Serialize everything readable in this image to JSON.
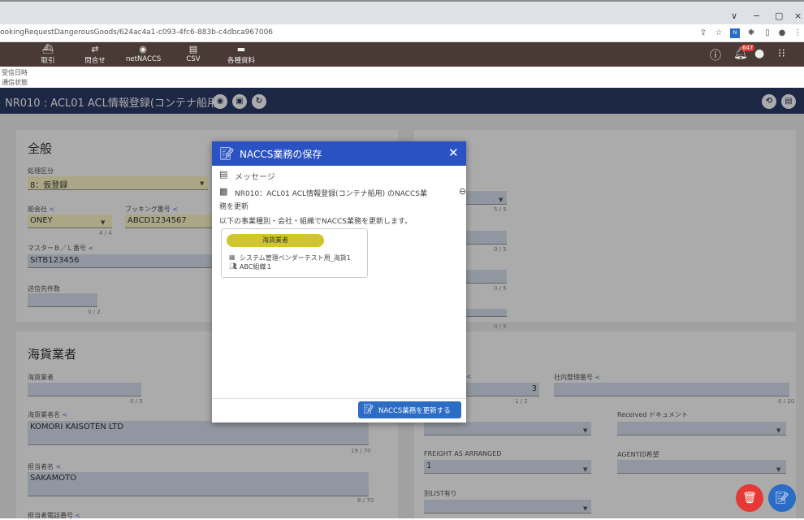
{
  "browser": {
    "url": "ookingRequestDangerousGoods/624ac4a1-c093-4fc6-883b-c4dbca967006",
    "window_controls": [
      "∨",
      "−",
      "▢",
      "×"
    ]
  },
  "toolbar": {
    "items": [
      {
        "label": "取引",
        "icon": "ship-icon"
      },
      {
        "label": "問合せ",
        "icon": "exchange-icon"
      },
      {
        "label": "netNACCS",
        "icon": "globe-icon"
      },
      {
        "label": "CSV",
        "icon": "file-icon"
      },
      {
        "label": "各種資料",
        "icon": "folder-icon"
      }
    ],
    "notification_count": "647"
  },
  "info": {
    "received_datetime_label": "受信日時",
    "comm_status_label": "通信状態"
  },
  "page": {
    "title": "NR010 : ACL01 ACL情報登録(コンテナ船用)"
  },
  "general": {
    "title": "全般",
    "processing_label": "処理区分",
    "processing_value": "8：仮登録",
    "carrier_label": "船会社",
    "carrier_value": "ONEY",
    "carrier_count": "4 / 4",
    "booking_label": "ブッキング番号",
    "booking_value": "ABCD1234567",
    "master_bl_label": "マスターＢ／Ｌ番号",
    "master_bl_value": "SITB123456",
    "sender_label": "送信先件数",
    "sender_count": "0 / 2"
  },
  "right_top": {
    "count1": "5 / 5",
    "count2": "0 / 5",
    "count3": "0 / 5",
    "count4": "0 / 5"
  },
  "forwarder": {
    "title": "海貨業者",
    "code_label": "海貨業者",
    "code_count": "0 / 5",
    "name_label": "海貨業者名",
    "name_value": "KOMORI KAISOTEN LTD",
    "name_count": "19 / 70",
    "person_label": "担当者名",
    "person_value": "SAKAMOTO",
    "person_count": "8 / 70",
    "phone_label": "担当者電話番号"
  },
  "right_bottom": {
    "value3": "3",
    "count_1_2": "1 / 2",
    "internal_label": "社内整理番号",
    "internal_count": "0 / 20",
    "received_doc_label": "Received ドキュメント",
    "freight_label": "FREIGHT AS ARRANGED",
    "freight_value": "1",
    "agent_label": "AGENT印希望",
    "list_label": "別LIST有り"
  },
  "dialog": {
    "title": "NACCS業務の保存",
    "message_label": "メッセージ",
    "message_line1": "NR010：ACL01 ACL情報登録(コンテナ船用) のNACCS業",
    "message_line2": "務を更新",
    "message_line3": "以下の事業種別・会社・組織でNACCS業務を更新します。",
    "chip": "海貨業者",
    "company": "システム管理ベンダーテスト用_海貨1",
    "organization": "ABC組織１",
    "update_button": "NACCS業務を更新する"
  },
  "colors": {
    "header": "#2b3a67",
    "toolbar": "#4a3a35",
    "dialog_header": "#2b52c2",
    "chip": "#cfc52c",
    "field": "#d8e1ef",
    "delete": "#e53935",
    "save": "#2b6cc4"
  }
}
